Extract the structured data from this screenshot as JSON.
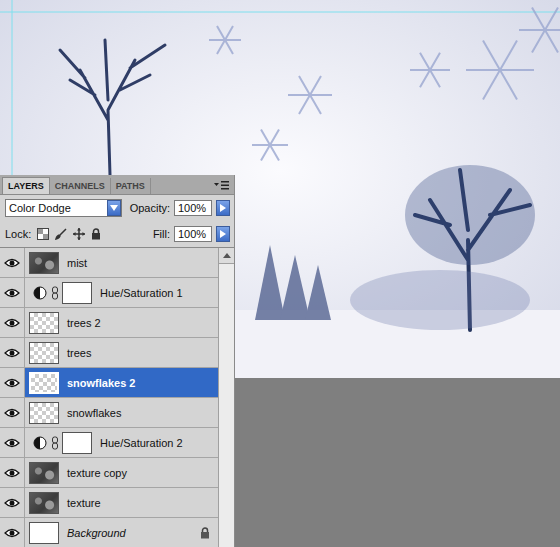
{
  "panel": {
    "tabs": [
      {
        "label": "LAYERS",
        "selected": true
      },
      {
        "label": "CHANNELS",
        "selected": false
      },
      {
        "label": "PATHS",
        "selected": false
      }
    ],
    "blend_mode": "Color Dodge",
    "opacity": {
      "label": "Opacity:",
      "value": "100%"
    },
    "lock": {
      "label": "Lock:"
    },
    "fill": {
      "label": "Fill:",
      "value": "100%"
    }
  },
  "layers": [
    {
      "name": "mist",
      "kind": "image",
      "visible": true,
      "selected": false,
      "locked": false
    },
    {
      "name": "Hue/Saturation 1",
      "kind": "adjustment",
      "visible": true,
      "selected": false,
      "locked": false
    },
    {
      "name": "trees 2",
      "kind": "transparent",
      "visible": true,
      "selected": false,
      "locked": false
    },
    {
      "name": "trees",
      "kind": "transparent",
      "visible": true,
      "selected": false,
      "locked": false
    },
    {
      "name": "snowflakes 2",
      "kind": "transparent",
      "visible": true,
      "selected": true,
      "locked": false
    },
    {
      "name": "snowflakes",
      "kind": "transparent",
      "visible": true,
      "selected": false,
      "locked": false
    },
    {
      "name": "Hue/Saturation 2",
      "kind": "adjustment",
      "visible": true,
      "selected": false,
      "locked": false
    },
    {
      "name": "texture copy",
      "kind": "image",
      "visible": true,
      "selected": false,
      "locked": false
    },
    {
      "name": "texture",
      "kind": "image",
      "visible": true,
      "selected": false,
      "locked": false
    },
    {
      "name": "Background",
      "kind": "background",
      "visible": true,
      "selected": false,
      "locked": true
    }
  ]
}
